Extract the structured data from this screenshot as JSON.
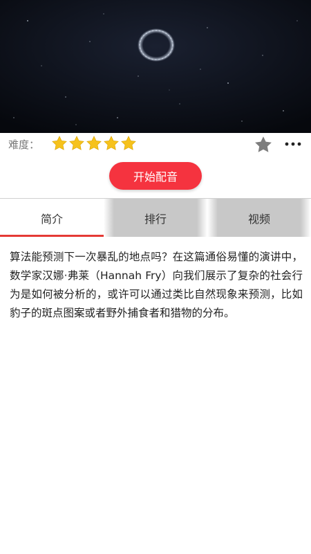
{
  "video": {
    "icon": "video-thumbnail"
  },
  "rating": {
    "label": "难度：",
    "stars_filled": 5,
    "stars_total": 5,
    "star_color": "#f6c21c",
    "favorite_icon": "star-icon",
    "favorite_color": "#7d7d7d",
    "more_icon": "more-dots-icon"
  },
  "action": {
    "dub_label": "开始配音",
    "dub_color": "#f5333f"
  },
  "tabs": [
    {
      "label": "简介",
      "active": true
    },
    {
      "label": "排行",
      "active": false
    },
    {
      "label": "视频",
      "active": false
    }
  ],
  "description": "算法能预测下一次暴乱的地点吗？在这篇通俗易懂的演讲中，数学家汉娜·弗莱（Hannah Fry）向我们展示了复杂的社会行为是如何被分析的，或许可以通过类比自然现象来预测，比如豹子的斑点图案或者野外捕食者和猎物的分布。",
  "colors": {
    "accent": "#e53935",
    "tab_inactive_bg": "#c8c8c8"
  }
}
